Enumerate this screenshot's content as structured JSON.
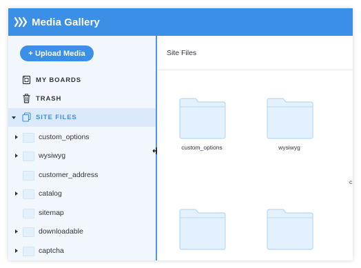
{
  "app": {
    "title": "Media Gallery"
  },
  "sidebar": {
    "upload_label": "+ Upload Media",
    "nav": [
      {
        "label": "MY BOARDS",
        "icon": "boards-icon"
      },
      {
        "label": "TRASH",
        "icon": "trash-icon"
      },
      {
        "label": "SITE FILES",
        "icon": "site-files-icon",
        "active": true
      }
    ],
    "folders": [
      {
        "label": "custom_options",
        "expandable": true
      },
      {
        "label": "wysiwyg",
        "expandable": true
      },
      {
        "label": "customer_address",
        "expandable": false
      },
      {
        "label": "catalog",
        "expandable": true
      },
      {
        "label": "sitemap",
        "expandable": false
      },
      {
        "label": "downloadable",
        "expandable": true
      },
      {
        "label": "captcha",
        "expandable": true
      }
    ]
  },
  "main": {
    "title": "Site Files",
    "cards": [
      {
        "name": "custom_options"
      },
      {
        "name": "wysiwyg"
      },
      {
        "name": "c"
      },
      {
        "name": ""
      },
      {
        "name": ""
      }
    ]
  },
  "colors": {
    "header": "#3b8fe6",
    "sidebar_bg": "#f1f7fd",
    "active_bg": "#dbeafb",
    "folder_fill": "#e3f0fd",
    "folder_stroke": "#b9d8f5"
  }
}
